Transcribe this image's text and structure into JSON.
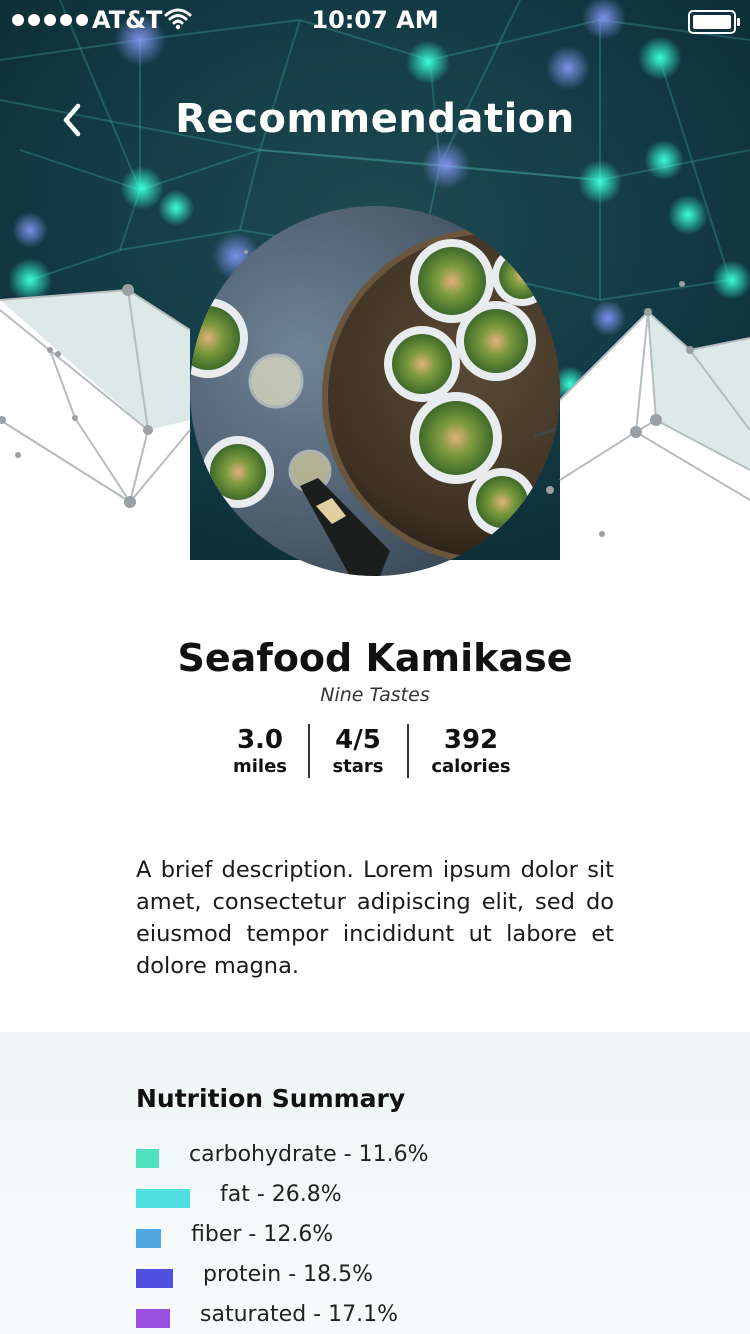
{
  "status_bar": {
    "carrier": "AT&T",
    "time": "10:07 AM"
  },
  "nav": {
    "title": "Recommendation"
  },
  "restaurant": {
    "dish": "Seafood Kamikase",
    "place": "Nine Tastes",
    "stats": [
      {
        "value": "3.0",
        "unit": "miles"
      },
      {
        "value": "4/5",
        "unit": "stars"
      },
      {
        "value": "392",
        "unit": "calories"
      }
    ],
    "description": "A brief description. Lorem ipsum dolor sit amet, consectetur adipiscing elit, sed do eiusmod tempor incididunt ut labore et dolore magna."
  },
  "nutrition": {
    "title": "Nutrition Summary",
    "items": [
      {
        "label": "carbohydrate - 11.6%",
        "percent": 11.6,
        "color": "#4fe0bd"
      },
      {
        "label": "fat - 26.8%",
        "percent": 26.8,
        "color": "#4fdfe0"
      },
      {
        "label": "fiber - 12.6%",
        "percent": 12.6,
        "color": "#4fa6e0"
      },
      {
        "label": "protein - 18.5%",
        "percent": 18.5,
        "color": "#5050e0"
      },
      {
        "label": "saturated - 17.1%",
        "percent": 17.1,
        "color": "#9a4fe0"
      }
    ]
  },
  "colors": {
    "hero_dark": "#0f3a3a",
    "hero_glow": "#22e0c0",
    "mesh_light": "#dceaea"
  }
}
